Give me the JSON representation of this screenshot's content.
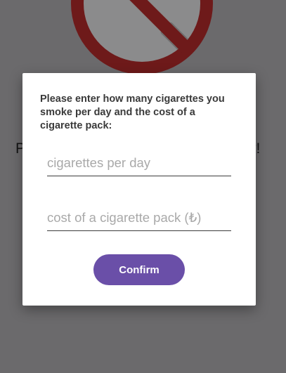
{
  "background": {
    "welcome_start": "P",
    "welcome_end": "y!",
    "logo_icon": "no-smoking-icon"
  },
  "dialog": {
    "message": "Please enter how many cigarettes you smoke per day and the cost of a cigarette pack:",
    "cigarettes_placeholder": "cigarettes per day",
    "cost_placeholder": "cost of a cigarette pack (₺)",
    "confirm_label": "Confirm"
  },
  "colors": {
    "accent": "#6a4fa8",
    "scrim": "#6b6a6c",
    "no_smoking_red": "#b81f1f"
  }
}
